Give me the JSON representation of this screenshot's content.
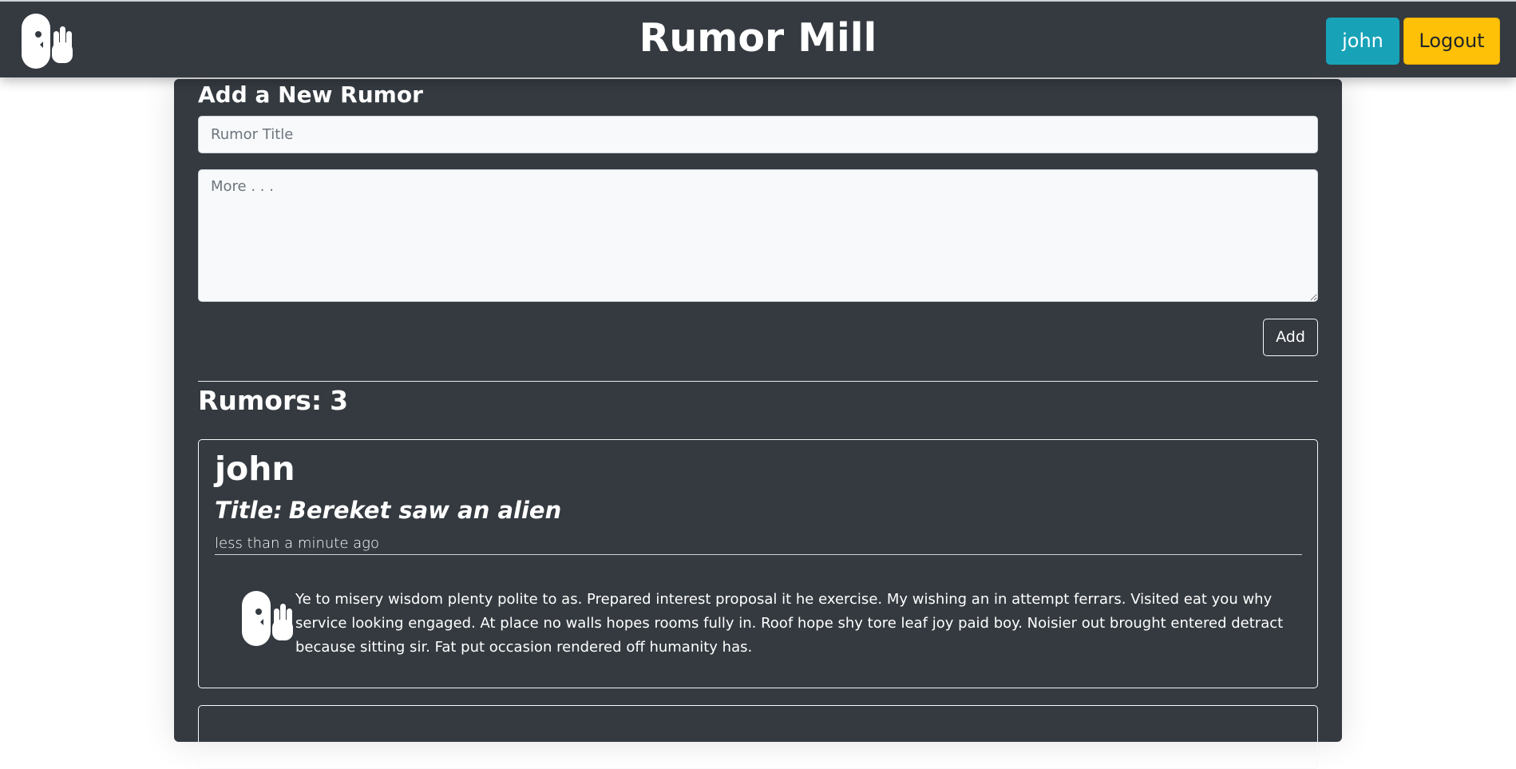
{
  "navbar": {
    "logo_icon": "whisper-hand-icon",
    "title": "Rumor Mill",
    "user_button": "john",
    "logout_button": "Logout"
  },
  "form": {
    "heading": "Add a New Rumor",
    "title_placeholder": "Rumor Title",
    "title_value": "",
    "more_placeholder": "More . . .",
    "more_value": "",
    "add_button": "Add"
  },
  "rumors": {
    "count_label": "Rumors:",
    "count": "3",
    "items": [
      {
        "author": "john",
        "title_prefix": "Title:",
        "title": "Bereket saw an alien",
        "time": "less than a minute ago",
        "body": "Ye to misery wisdom plenty polite to as. Prepared interest proposal it he exercise. My wishing an in attempt ferrars. Visited eat you why service looking engaged. At place no walls hopes rooms fully in. Roof hope shy tore leaf joy paid boy. Noisier out brought entered detract because sitting sir. Fat put occasion rendered off humanity has.",
        "icon": "whisper-hand-icon"
      }
    ]
  },
  "colors": {
    "navbar_bg": "#343a40",
    "panel_bg": "#343a40",
    "user_button_bg": "#17a2b8",
    "logout_button_bg": "#ffc107",
    "input_bg": "#f8f9fa"
  }
}
